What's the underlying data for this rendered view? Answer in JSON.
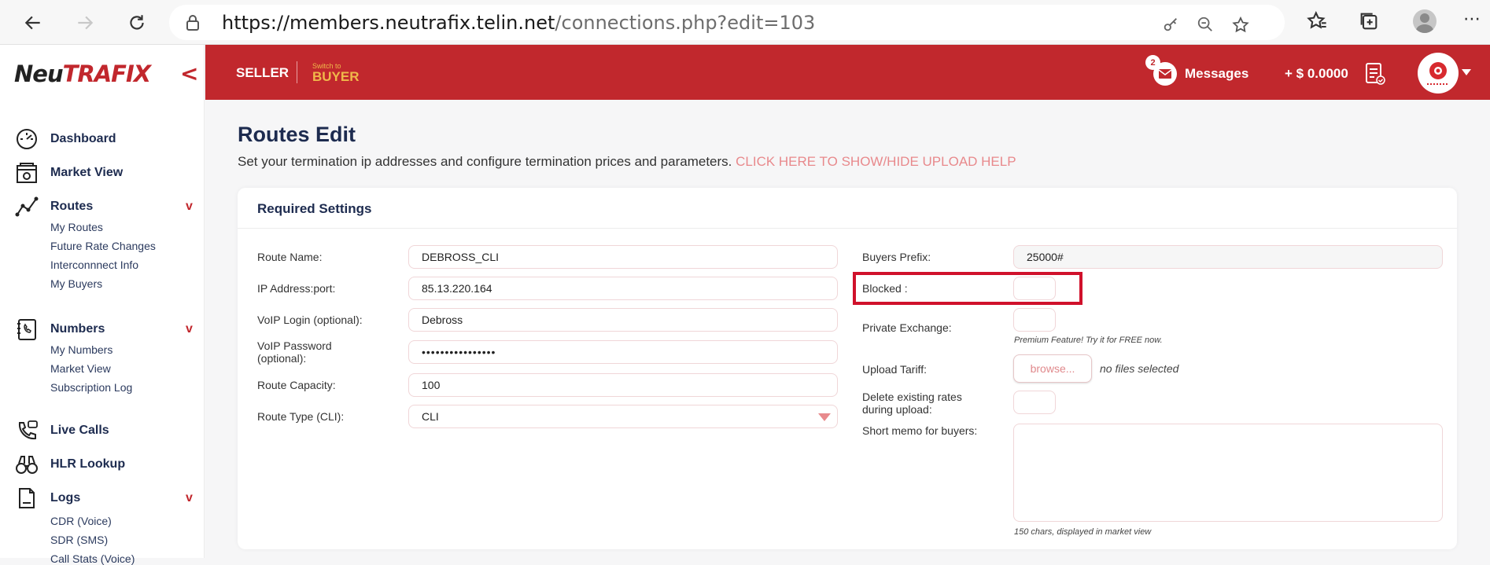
{
  "browser": {
    "url_host": "https://members.neutrafix.telin.net",
    "url_path": "/connections.php?edit=103"
  },
  "sidebar": {
    "logo_left": "Neu",
    "logo_right": "TRAFIX",
    "collapse_label": "<",
    "sections": [
      {
        "label": "Dashboard",
        "icon": "dashboard-icon"
      },
      {
        "label": "Market View",
        "icon": "market-icon"
      },
      {
        "label": "Routes",
        "icon": "routes-icon",
        "caret": "v",
        "items": [
          "My Routes",
          "Future Rate Changes",
          "Interconnnect Info",
          "My Buyers"
        ]
      },
      {
        "label": "Numbers",
        "icon": "numbers-icon",
        "caret": "v",
        "items": [
          "My Numbers",
          "Market View",
          "Subscription Log"
        ]
      },
      {
        "label": "Live Calls",
        "icon": "live-calls-icon"
      },
      {
        "label": "HLR Lookup",
        "icon": "binoculars-icon"
      },
      {
        "label": "Logs",
        "icon": "logs-icon",
        "caret": "v",
        "items": [
          "CDR (Voice)",
          "SDR (SMS)",
          "Call Stats (Voice)"
        ]
      }
    ]
  },
  "topbar": {
    "seller": "SELLER",
    "switch_to": "Switch to",
    "buyer": "BUYER",
    "messages_count": "2",
    "messages_label": "Messages",
    "balance": "+ $ 0.0000",
    "colors": {
      "bar": "#c1282d",
      "buyer": "#f0b84a"
    }
  },
  "main": {
    "title": "Routes Edit",
    "subtitle": "Set your termination ip addresses and configure termination prices and parameters. ",
    "help_link": "CLICK HERE TO SHOW/HIDE UPLOAD HELP",
    "card_title": "Required Settings",
    "left_fields": [
      {
        "label": "Route Name:",
        "value": "DEBROSS_CLI"
      },
      {
        "label": "IP Address:port:",
        "value": "85.13.220.164"
      },
      {
        "label": "VoIP Login (optional):",
        "value": "Debross"
      },
      {
        "label": "VoIP Password (optional):",
        "value": "••••••••••••••••"
      },
      {
        "label": "Route Capacity:",
        "value": "100"
      },
      {
        "label": "Route Type (CLI):",
        "value": "CLI"
      }
    ],
    "right_fields": {
      "buyers_prefix_label": "Buyers Prefix:",
      "buyers_prefix_value": "25000#",
      "blocked_label": "Blocked :",
      "private_exchange_label": "Private Exchange:",
      "premium_note": "Premium Feature! Try it for FREE now.",
      "upload_tariff_label": "Upload Tariff:",
      "browse_label": "browse...",
      "no_files": "no files selected",
      "delete_rates_label": "Delete existing rates during upload:",
      "memo_label": "Short memo for buyers:",
      "memo_note": "150 chars, displayed in market view"
    }
  }
}
